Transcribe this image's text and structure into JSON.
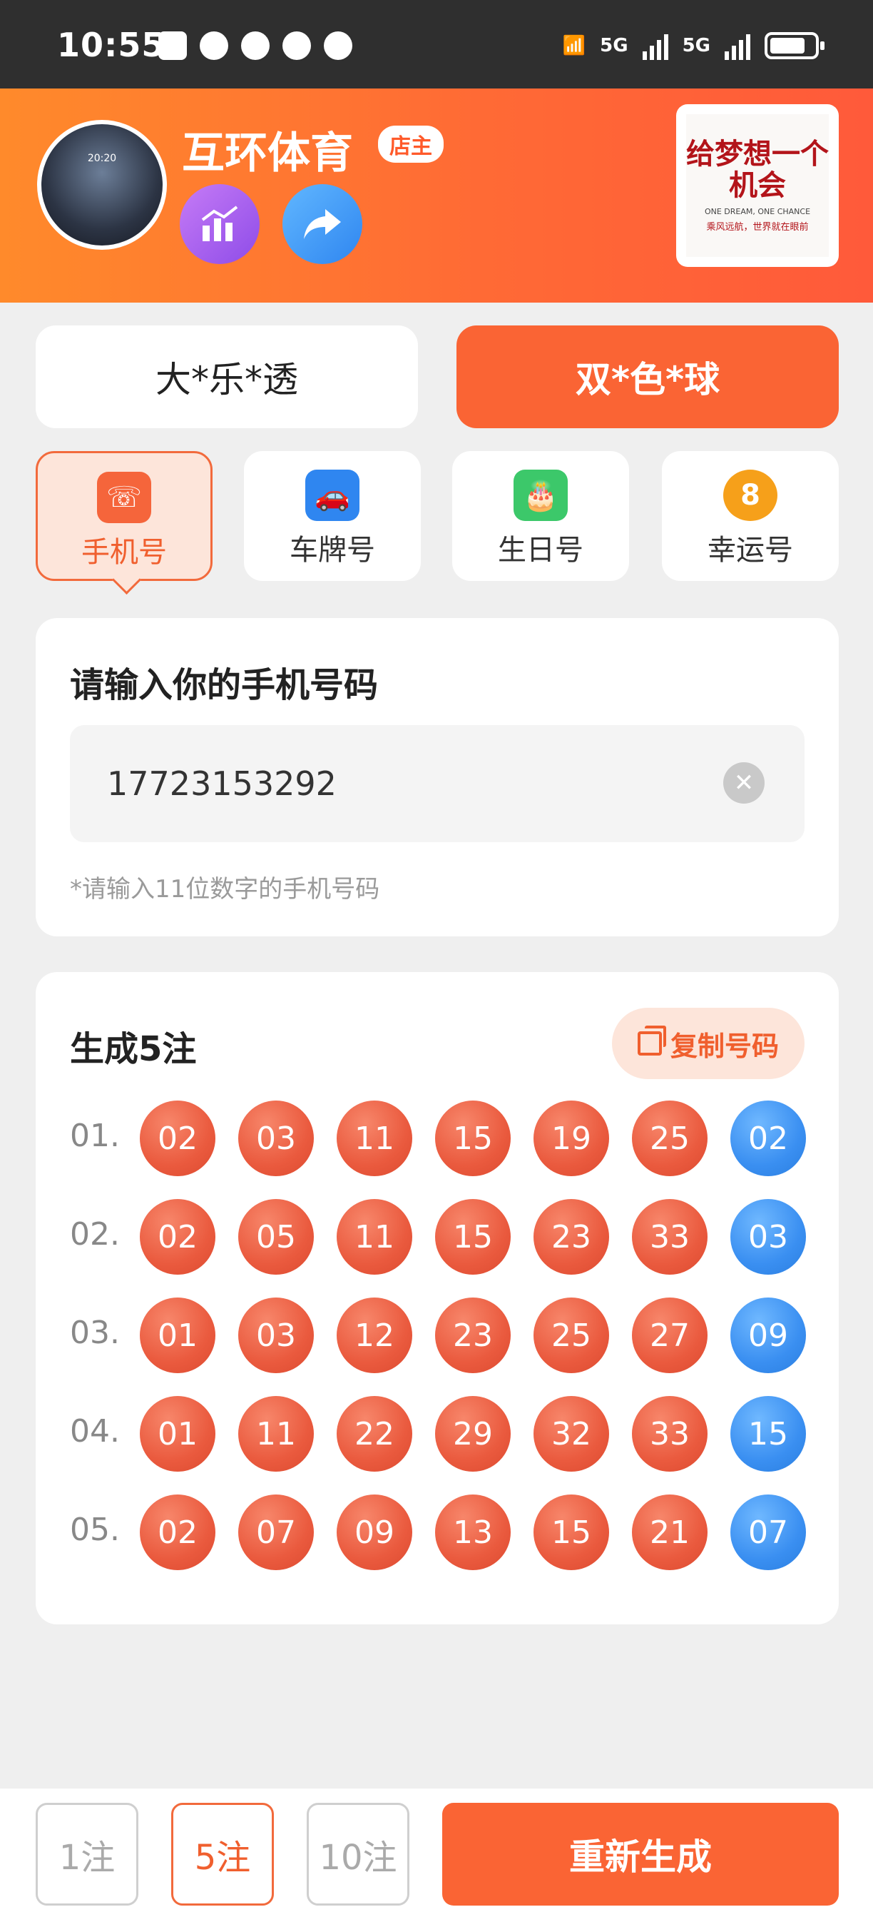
{
  "status_bar": {
    "time": "10:55",
    "signal1": "5G",
    "signal2": "5G"
  },
  "header": {
    "shop_name": "互环体育",
    "owner_badge": "店主",
    "avatar_caption": "20:20",
    "logo_main": "给梦想一个机会",
    "logo_en": "ONE DREAM, ONE CHANCE",
    "logo_sub": "乘风远航，世界就在眼前"
  },
  "lottery_tabs": [
    {
      "label": "大*乐*透",
      "selected": false
    },
    {
      "label": "双*色*球",
      "selected": true
    }
  ],
  "mode_tabs": [
    {
      "label": "手机号",
      "icon": "phone-icon",
      "color": "#f5653b",
      "selected": true
    },
    {
      "label": "车牌号",
      "icon": "car-icon",
      "color": "#2f86f0",
      "selected": false
    },
    {
      "label": "生日号",
      "icon": "cake-icon",
      "color": "#3cc86a",
      "selected": false
    },
    {
      "label": "幸运号",
      "icon": "lucky-eight-icon",
      "color": "#f6a01a",
      "selected": false
    }
  ],
  "input_card": {
    "title": "请输入你的手机号码",
    "value": "17723153292",
    "hint": "*请输入11位数字的手机号码"
  },
  "result_card": {
    "title": "生成5注",
    "copy_label": "复制号码",
    "rows": [
      {
        "index": "01.",
        "red": [
          "02",
          "03",
          "11",
          "15",
          "19",
          "25"
        ],
        "blue": "02"
      },
      {
        "index": "02.",
        "red": [
          "02",
          "05",
          "11",
          "15",
          "23",
          "33"
        ],
        "blue": "03"
      },
      {
        "index": "03.",
        "red": [
          "01",
          "03",
          "12",
          "23",
          "25",
          "27"
        ],
        "blue": "09"
      },
      {
        "index": "04.",
        "red": [
          "01",
          "11",
          "22",
          "29",
          "32",
          "33"
        ],
        "blue": "15"
      },
      {
        "index": "05.",
        "red": [
          "02",
          "07",
          "09",
          "13",
          "15",
          "21"
        ],
        "blue": "07"
      }
    ]
  },
  "bottom_bar": {
    "options": [
      {
        "label": "1注",
        "selected": false
      },
      {
        "label": "5注",
        "selected": true
      },
      {
        "label": "10注",
        "selected": false
      }
    ],
    "regenerate_label": "重新生成"
  },
  "colors": {
    "accent": "#fa6434",
    "red_ball": "#ea5a3e",
    "blue_ball": "#3a8ff1"
  }
}
